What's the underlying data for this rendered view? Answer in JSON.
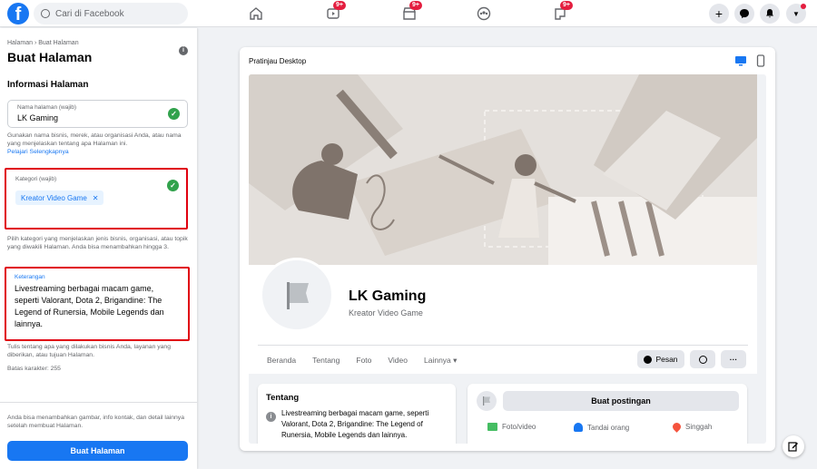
{
  "topbar": {
    "search_placeholder": "Cari di Facebook",
    "badges": {
      "watch": "9+",
      "marketplace": "9+",
      "gaming": "9+"
    }
  },
  "sidebar": {
    "breadcrumb": "Halaman › Buat Halaman",
    "title": "Buat Halaman",
    "section_heading": "Informasi Halaman",
    "name_field": {
      "label": "Nama halaman (wajib)",
      "value": "LK Gaming"
    },
    "name_help": "Gunakan nama bisnis, merek, atau organisasi Anda, atau nama yang menjelaskan tentang apa Halaman ini.",
    "learn_more": "Pelajari Selengkapnya",
    "category_field": {
      "label": "Kategori (wajib)",
      "chip": "Kreator Video Game"
    },
    "category_help": "Pilih kategori yang menjelaskan jenis bisnis, organisasi, atau topik yang diwakili Halaman. Anda bisa menambahkan hingga 3.",
    "description_field": {
      "label": "Keterangan",
      "value": "Livestreaming berbagai macam game, seperti Valorant, Dota 2, Brigandine: The Legend of Runersia, Mobile Legends dan lainnya."
    },
    "description_help": "Tulis tentang apa yang dilakukan bisnis Anda, layanan yang diberikan, atau tujuan Halaman.",
    "char_limit": "Batas karakter: 255",
    "footer_note": "Anda bisa menambahkan gambar, info kontak, dan detail lainnya setelah membuat Halaman.",
    "create_button": "Buat Halaman"
  },
  "preview": {
    "title": "Pratinjau Desktop",
    "page_name": "LK Gaming",
    "page_category": "Kreator Video Game",
    "tabs": [
      "Beranda",
      "Tentang",
      "Foto",
      "Video",
      "Lainnya ▾"
    ],
    "message_button": "Pesan",
    "about": {
      "heading": "Tentang",
      "text": "Livestreaming berbagai macam game, seperti Valorant, Dota 2, Brigandine: The Legend of Runersia, Mobile Legends dan lainnya."
    },
    "create_post": "Buat postingan",
    "post_actions": [
      "Foto/video",
      "Tandai orang",
      "Singgah"
    ]
  },
  "colors": {
    "accent": "#1877f2",
    "highlight_box": "#e0000f",
    "success": "#31a24c"
  }
}
